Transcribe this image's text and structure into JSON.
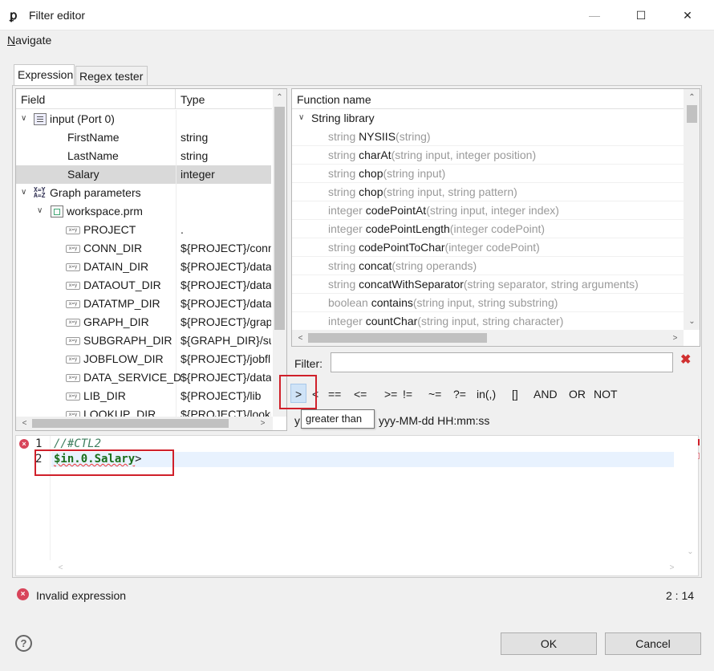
{
  "window": {
    "title": "Filter editor",
    "minimize_glyph": "—",
    "maximize_glyph": "☐",
    "close_glyph": "✕",
    "app_glyph": "ꝑ"
  },
  "menu": {
    "navigate": "Navigate"
  },
  "tabs": [
    {
      "label": "Expression",
      "active": true
    },
    {
      "label": "Regex tester",
      "active": false
    }
  ],
  "fields": {
    "col_field": "Field",
    "col_type": "Type",
    "rows": [
      {
        "name": "input (Port 0)",
        "type": "",
        "icon": "port-icon"
      },
      {
        "name": "FirstName",
        "type": "string"
      },
      {
        "name": "LastName",
        "type": "string"
      },
      {
        "name": "Salary",
        "type": "integer",
        "selected": true
      },
      {
        "name": "Graph parameters",
        "type": "",
        "icon": "graph-params-icon"
      },
      {
        "name": "workspace.prm",
        "type": "",
        "icon": "prm-file-icon"
      },
      {
        "name": "PROJECT",
        "type": ".",
        "icon": "param-icon"
      },
      {
        "name": "CONN_DIR",
        "type": "${PROJECT}/conn",
        "icon": "param-icon"
      },
      {
        "name": "DATAIN_DIR",
        "type": "${PROJECT}/data",
        "icon": "param-icon"
      },
      {
        "name": "DATAOUT_DIR",
        "type": "${PROJECT}/data",
        "icon": "param-icon"
      },
      {
        "name": "DATATMP_DIR",
        "type": "${PROJECT}/data",
        "icon": "param-icon"
      },
      {
        "name": "GRAPH_DIR",
        "type": "${PROJECT}/grap",
        "icon": "param-icon"
      },
      {
        "name": "SUBGRAPH_DIR",
        "type": "${GRAPH_DIR}/su",
        "icon": "param-icon"
      },
      {
        "name": "JOBFLOW_DIR",
        "type": "${PROJECT}/jobfl",
        "icon": "param-icon"
      },
      {
        "name": "DATA_SERVICE_D",
        "type": "${PROJECT}/data",
        "icon": "param-icon"
      },
      {
        "name": "LIB_DIR",
        "type": "${PROJECT}/lib",
        "icon": "param-icon"
      },
      {
        "name": "LOOKUP_DIR",
        "type": "${PROJECT}/looku",
        "icon": "param-icon"
      }
    ]
  },
  "functions": {
    "col_name": "Function name",
    "group": "String library",
    "rows": [
      {
        "ret": "string",
        "name": "NYSIIS",
        "args": "(string)"
      },
      {
        "ret": "string",
        "name": "charAt",
        "args": "(string input, integer position)"
      },
      {
        "ret": "string",
        "name": "chop",
        "args": "(string input)"
      },
      {
        "ret": "string",
        "name": "chop",
        "args": "(string input, string pattern)"
      },
      {
        "ret": "integer",
        "name": "codePointAt",
        "args": "(string input, integer index)"
      },
      {
        "ret": "integer",
        "name": "codePointLength",
        "args": "(integer codePoint)"
      },
      {
        "ret": "string",
        "name": "codePointToChar",
        "args": "(integer codePoint)"
      },
      {
        "ret": "string",
        "name": "concat",
        "args": "(string operands)"
      },
      {
        "ret": "string",
        "name": "concatWithSeparator",
        "args": "(string separator, string arguments)"
      },
      {
        "ret": "boolean",
        "name": "contains",
        "args": "(string input, string substring)"
      },
      {
        "ret": "integer",
        "name": "countChar",
        "args": "(string input, string character)"
      }
    ]
  },
  "filter": {
    "label": "Filter:",
    "value": "",
    "clear_glyph": "✖"
  },
  "operators": [
    ">",
    "<",
    "==",
    "<=",
    ">=",
    "!=",
    "~=",
    "?=",
    "in(,)",
    "[]",
    "AND",
    "OR",
    "NOT"
  ],
  "tooltip": "greater than",
  "date_format": {
    "prefix": "y",
    "rest": "yyy-MM-dd HH:mm:ss"
  },
  "editor": {
    "line_numbers": [
      "1",
      "2"
    ],
    "line1": "//#CTL2",
    "line2_var": "$in.0.Salary",
    "line2_op": ">"
  },
  "status": {
    "text": "Invalid expression",
    "cursor": "2 : 14"
  },
  "buttons": {
    "help": "?",
    "ok": "OK",
    "cancel": "Cancel"
  },
  "colors": {
    "highlight_red": "#d0202a",
    "selection": "#d9d9d9",
    "op_button": "#cfe3f7"
  }
}
